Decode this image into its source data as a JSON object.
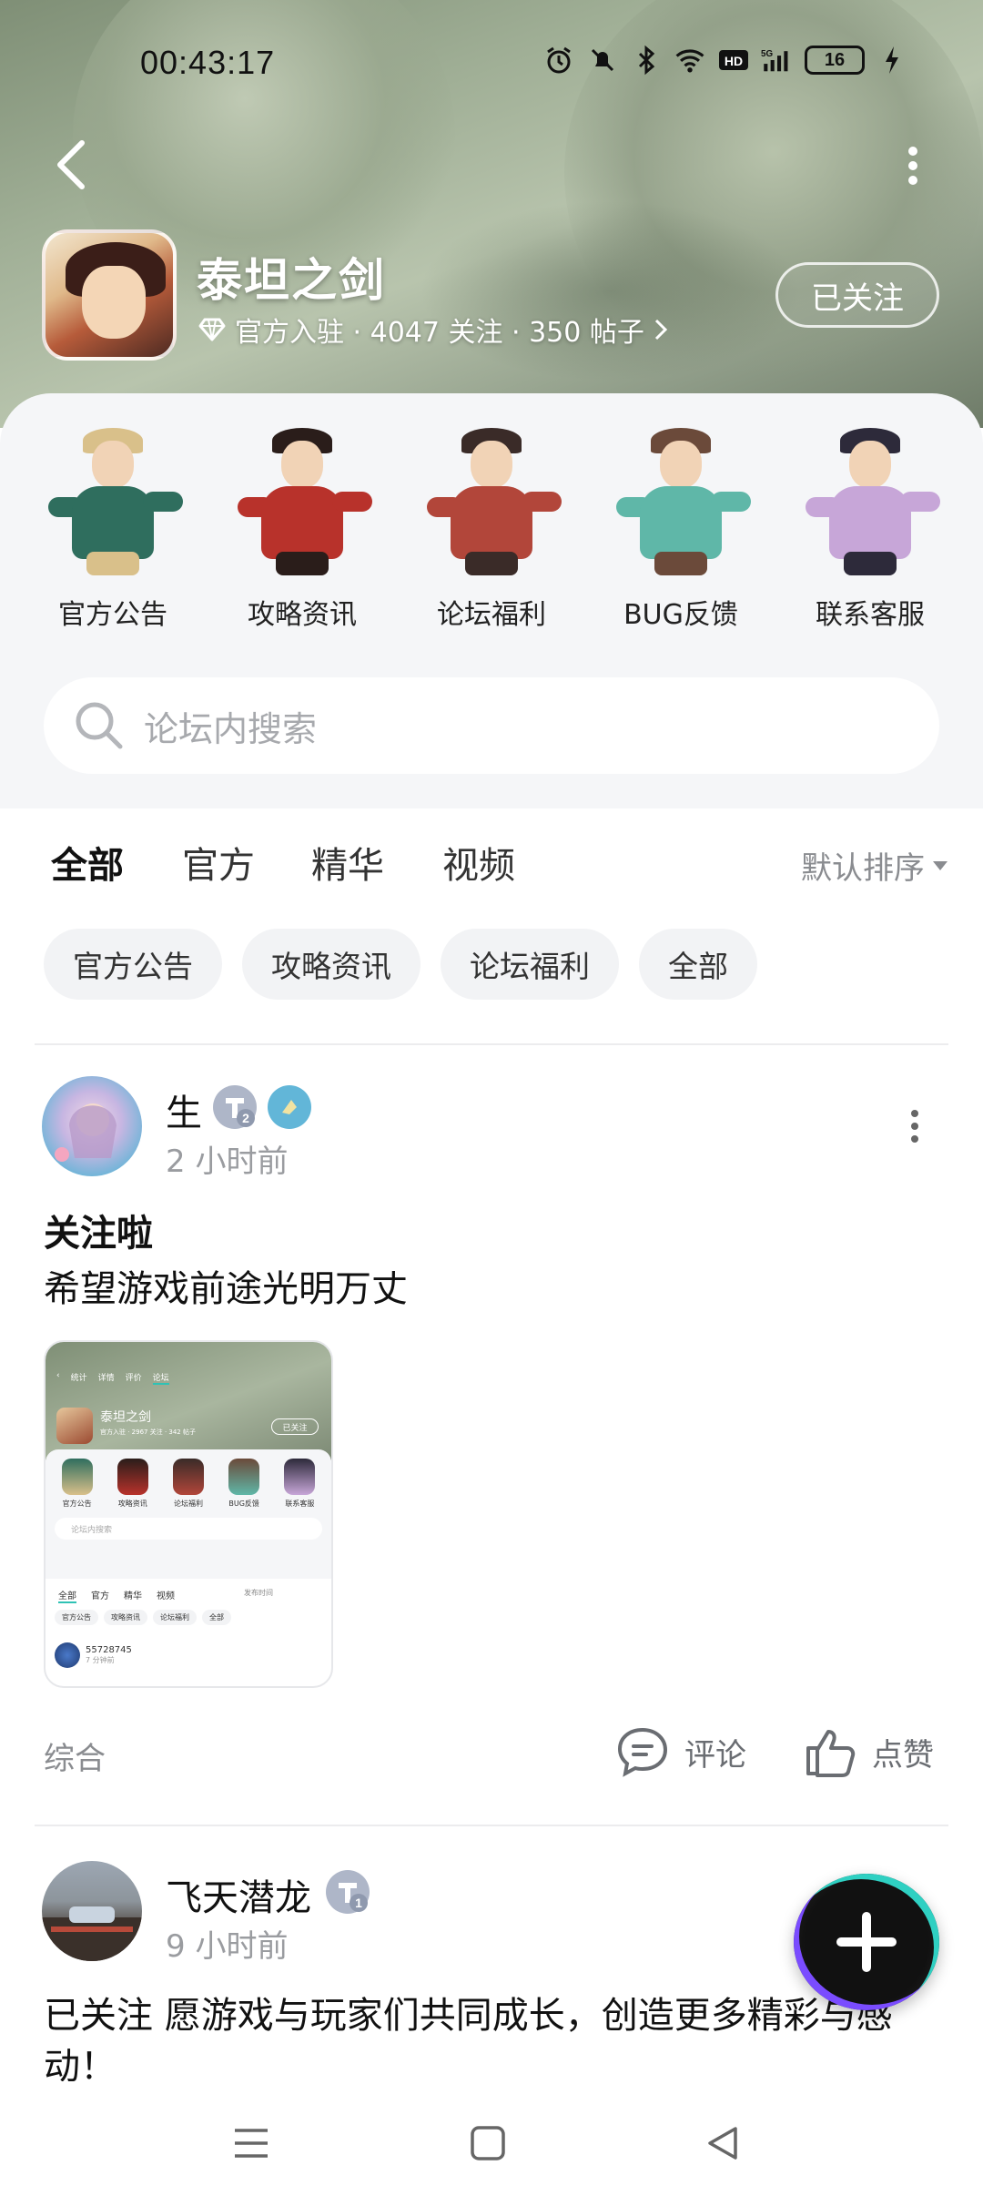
{
  "status_bar": {
    "time": "00:43:17",
    "battery": "16"
  },
  "header": {
    "game_title": "泰坦之剑",
    "meta": "官方入驻 · 4047 关注 · 350 帖子",
    "follow_label": "已关注"
  },
  "quick_links": [
    {
      "label": "官方公告",
      "colors": [
        "#2f6e5e",
        "#d9c08a"
      ]
    },
    {
      "label": "攻略资讯",
      "colors": [
        "#b8322b",
        "#2a1d1a"
      ]
    },
    {
      "label": "论坛福利",
      "colors": [
        "#b2463a",
        "#3a2b28"
      ]
    },
    {
      "label": "BUG反馈",
      "colors": [
        "#5fb7a8",
        "#6b4a3a"
      ]
    },
    {
      "label": "联系客服",
      "colors": [
        "#c7a6d8",
        "#2d2a3a"
      ]
    }
  ],
  "search": {
    "placeholder": "论坛内搜索"
  },
  "tabs": [
    {
      "label": "全部",
      "active": true
    },
    {
      "label": "官方",
      "active": false
    },
    {
      "label": "精华",
      "active": false
    },
    {
      "label": "视频",
      "active": false
    }
  ],
  "sort_label": "默认排序",
  "chips": [
    "官方公告",
    "攻略资讯",
    "论坛福利",
    "全部"
  ],
  "posts": [
    {
      "username": "生",
      "badge_level": "2",
      "time": "2 小时前",
      "title": "关注啦",
      "body": "希望游戏前途光明万丈",
      "category": "综合",
      "comment_label": "评论",
      "like_label": "点赞",
      "thumbnail": {
        "tabs": [
          "统计",
          "详情",
          "评价",
          "论坛"
        ],
        "title": "泰坦之剑",
        "meta": "官方入驻 · 2967 关注 · 342 帖子",
        "follow": "已关注",
        "cells": [
          "官方公告",
          "攻略资讯",
          "论坛福利",
          "BUG反馈",
          "联系客服"
        ],
        "search": "论坛内搜索",
        "subtabs": [
          "全部",
          "官方",
          "精华",
          "视频"
        ],
        "sort": "发布时间",
        "chips": [
          "官方公告",
          "攻略资讯",
          "论坛福利",
          "全部"
        ],
        "user": "55728745",
        "time": "7 分钟前"
      }
    },
    {
      "username": "飞天潜龙",
      "badge_level": "1",
      "time": "9 小时前",
      "body": "已关注 愿游戏与玩家们共同成长，创造更多精彩与感动！"
    }
  ],
  "accent_color": "#2fc2b5"
}
